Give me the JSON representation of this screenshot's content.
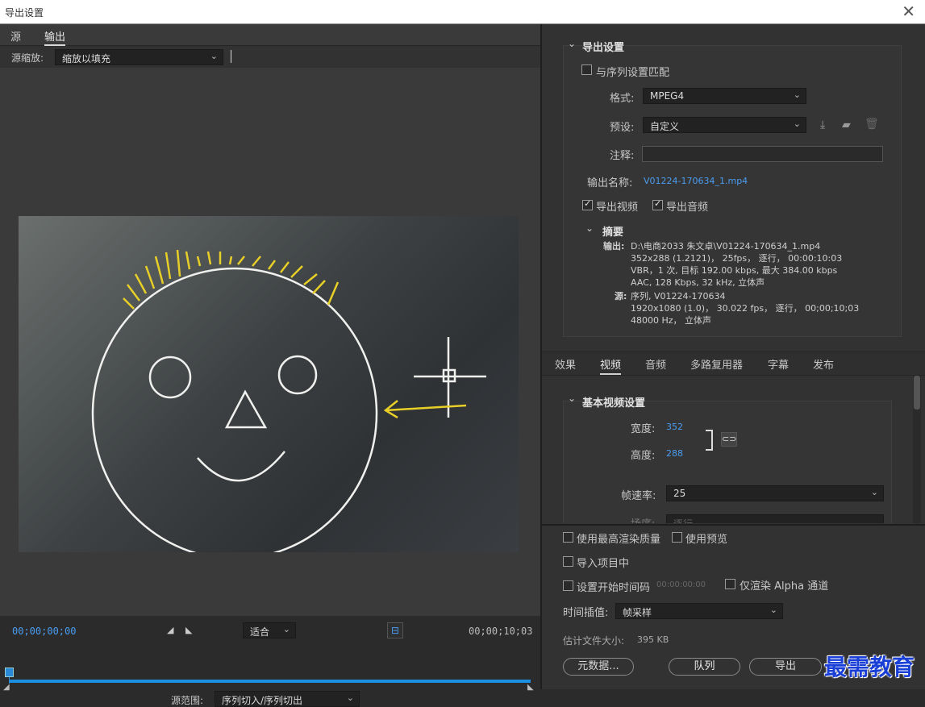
{
  "window": {
    "title": "导出设置",
    "close": "✕"
  },
  "left": {
    "tabs": [
      "源",
      "输出"
    ],
    "zoom_label": "源缩放:",
    "zoom_value": "缩放以填充",
    "timecode_start": "00;00;00;00",
    "timecode_end": "00;00;10;03",
    "fit_value": "适合",
    "range_label": "源范围:",
    "range_value": "序列切入/序列切出"
  },
  "export": {
    "section_title": "导出设置",
    "match_sequence": "与序列设置匹配",
    "format_label": "格式:",
    "format_value": "MPEG4",
    "preset_label": "预设:",
    "preset_value": "自定义",
    "comment_label": "注释:",
    "output_name_label": "输出名称:",
    "output_name_value": "V01224-170634_1.mp4",
    "export_video": "导出视频",
    "export_audio": "导出音频",
    "summary_title": "摘要",
    "output_key": "输出:",
    "output_lines": [
      "D:\\电商2033 朱文卓\\V01224-170634_1.mp4",
      "352x288 (1.2121)， 25fps， 逐行， 00:00:10:03",
      "VBR，1 次, 目标 192.00 kbps, 最大 384.00 kbps",
      "AAC, 128 Kbps, 32  kHz, 立体声"
    ],
    "source_key": "源:",
    "source_lines": [
      "序列, V01224-170634",
      "1920x1080 (1.0)， 30.022 fps， 逐行， 00;00;10;03",
      "48000 Hz， 立体声"
    ]
  },
  "settings_tabs": [
    "效果",
    "视频",
    "音频",
    "多路复用器",
    "字幕",
    "发布"
  ],
  "video": {
    "section_title": "基本视频设置",
    "width_label": "宽度:",
    "width_value": "352",
    "height_label": "高度:",
    "height_value": "288",
    "fps_label": "帧速率:",
    "fps_value": "25",
    "field_label": "场序:",
    "field_value": "逐行"
  },
  "bottom": {
    "max_quality": "使用最高渲染质量",
    "use_preview": "使用预览",
    "import_project": "导入项目中",
    "set_start_tc": "设置开始时间码",
    "start_tc_value": "00:00:00:00",
    "alpha_only": "仅渲染 Alpha 通道",
    "interp_label": "时间插值:",
    "interp_value": "帧采样",
    "filesize_label": "估计文件大小:",
    "filesize_value": "395 KB",
    "metadata_btn": "元数据...",
    "queue_btn": "队列",
    "export_btn": "导出"
  },
  "watermark": "最需教育",
  "colors": {
    "accent": "#4a9cf0",
    "playhead": "#2a8ad8"
  }
}
